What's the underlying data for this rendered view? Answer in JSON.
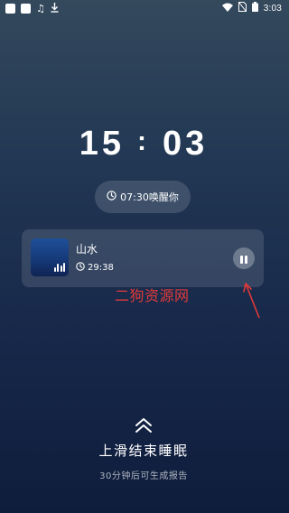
{
  "status_bar": {
    "time": "3:03",
    "left_icons": [
      "square-icon",
      "square-icon",
      "music-note-icon",
      "download-icon"
    ],
    "right_icons": [
      "wifi-icon",
      "no-sim-icon",
      "battery-icon"
    ]
  },
  "clock": {
    "hours": "15",
    "separator": ":",
    "minutes": "03"
  },
  "alarm": {
    "text": "07:30唤醒你",
    "icon": "alarm-clock-icon"
  },
  "player": {
    "track_title": "山水",
    "duration": "29:38",
    "cover_icon": "equalizer-icon",
    "duration_icon": "timer-icon",
    "control_icon": "pause-icon"
  },
  "watermark": {
    "text": "二狗资源网",
    "color": "#e03a3a"
  },
  "swipe": {
    "title": "上滑结束睡眠",
    "subtitle": "30分钟后可生成报告",
    "icon": "double-chevron-up-icon"
  }
}
